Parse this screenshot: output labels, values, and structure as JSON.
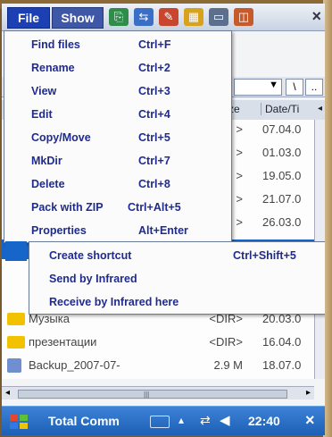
{
  "toolbar": {
    "menus": [
      "File",
      "Show"
    ],
    "icons": [
      "copy-icon",
      "move-icon",
      "edit-icon",
      "grid-icon",
      "cmd-icon",
      "panels-icon"
    ],
    "close_label": "×"
  },
  "pathbar": {
    "dropdown_value": "",
    "root_label": "\\",
    "up_label": ".."
  },
  "columns": {
    "size": "ze",
    "date": "Date/Ti"
  },
  "file_menu": {
    "items": [
      {
        "label": "Find files",
        "shortcut": "Ctrl+F"
      },
      {
        "label": "Rename",
        "shortcut": "Ctrl+2"
      },
      {
        "label": "View",
        "shortcut": "Ctrl+3"
      },
      {
        "label": "Edit",
        "shortcut": "Ctrl+4"
      },
      {
        "label": "Copy/Move",
        "shortcut": "Ctrl+5"
      },
      {
        "label": "MkDir",
        "shortcut": "Ctrl+7"
      },
      {
        "label": "Delete",
        "shortcut": "Ctrl+8"
      },
      {
        "label": "Pack with ZIP",
        "shortcut": "Ctrl+Alt+5"
      },
      {
        "label": "Properties",
        "shortcut": "Alt+Enter"
      }
    ]
  },
  "sub_menu": {
    "items": [
      {
        "label": "Create shortcut",
        "shortcut": "Ctrl+Shift+5"
      },
      {
        "label": "Send by Infrared",
        "shortcut": ""
      },
      {
        "label": "Receive by Infrared here",
        "shortcut": ""
      }
    ]
  },
  "file_rows": [
    {
      "name": "",
      "size": ">",
      "date": "07.04.0"
    },
    {
      "name": "",
      "size": ">",
      "date": "01.03.0"
    },
    {
      "name": "",
      "size": ">",
      "date": "19.05.0"
    },
    {
      "name": "",
      "size": ">",
      "date": "21.07.0"
    },
    {
      "name": "",
      "size": ">",
      "date": "26.03.0"
    },
    {
      "name": "Музыка",
      "size": "<DIR>",
      "date": "20.03.0"
    },
    {
      "name": "презентации",
      "size": "<DIR>",
      "date": "16.04.0"
    },
    {
      "name": "Backup_2007-07-",
      "size": "2.9 M",
      "date": "18.07.0"
    }
  ],
  "taskbar": {
    "title": "Total Comm",
    "clock": "22:40",
    "close_label": "×"
  },
  "colors": {
    "menu_text": "#1f2b8f",
    "highlight": "#1666c9",
    "taskbar": "#2a6ec4",
    "folder": "#f2c200"
  }
}
